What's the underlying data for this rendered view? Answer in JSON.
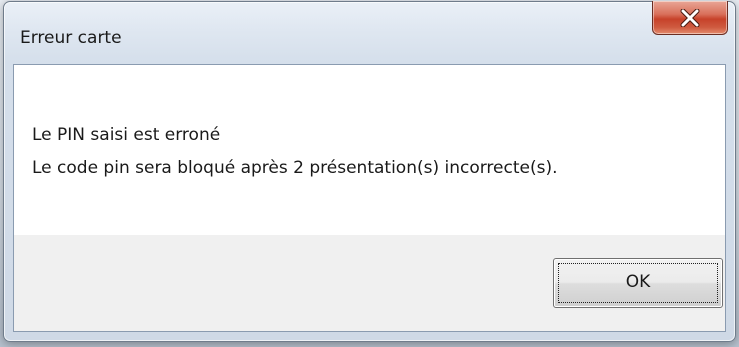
{
  "dialog": {
    "title": "Erreur carte",
    "close_icon": "close-icon",
    "message_lines": [
      "Le PIN saisi est erroné",
      "Le code pin sera bloqué après 2 présentation(s) incorrecte(s)."
    ],
    "ok_label": "OK"
  },
  "colors": {
    "close_button": "#c7422a",
    "client_background": "#ffffff",
    "button_area_background": "#f0f0f0"
  }
}
